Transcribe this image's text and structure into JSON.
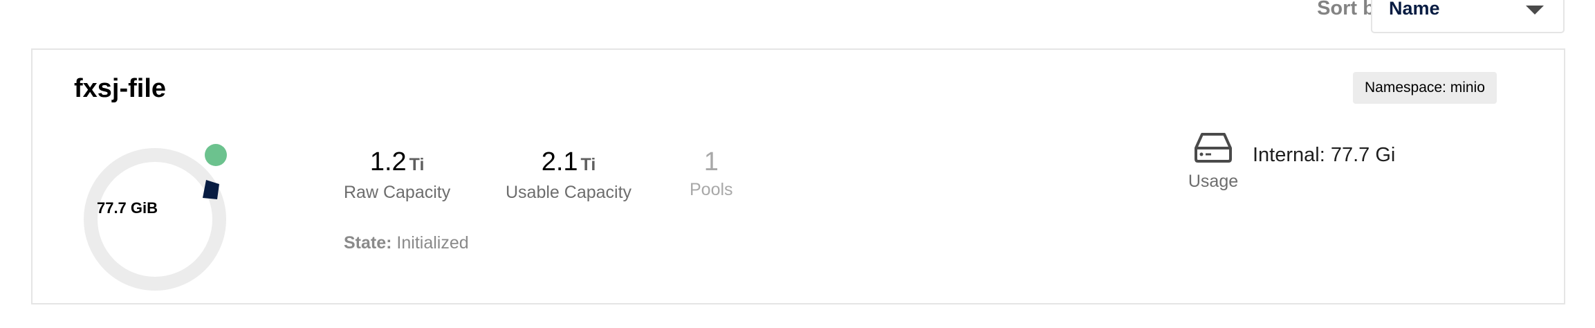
{
  "sort": {
    "label": "Sort by",
    "selected": "Name"
  },
  "tenant": {
    "name": "fxsj-file",
    "namespace": "Namespace: minio",
    "usage_total": "77.7 GiB",
    "raw_capacity": {
      "value": "1.2",
      "unit": "Ti",
      "label": "Raw Capacity"
    },
    "usable_capacity": {
      "value": "2.1",
      "unit": "Ti",
      "label": "Usable Capacity"
    },
    "pools": {
      "value": "1",
      "label": "Pools"
    },
    "state": {
      "label": "State:",
      "value": "Initialized"
    },
    "usage": {
      "label": "Usage",
      "icon": "disk-drive-icon"
    },
    "internal": "Internal: 77.7 Gi"
  },
  "colors": {
    "donut_track": "#ececec",
    "donut_used": "#081c42",
    "status_dot": "#6cc28e",
    "select_text": "#081c42"
  }
}
